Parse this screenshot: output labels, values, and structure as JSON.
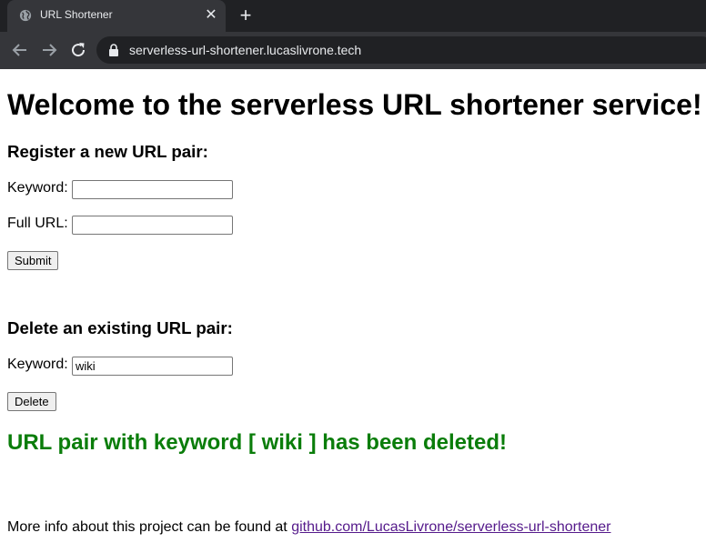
{
  "browser": {
    "tab_title": "URL Shortener",
    "tab_icon": "globe-icon",
    "url": "serverless-url-shortener.lucaslivrone.tech"
  },
  "page": {
    "title": "Welcome to the serverless URL shortener service!",
    "register": {
      "heading": "Register a new URL pair:",
      "keyword_label": "Keyword:",
      "keyword_value": "",
      "full_url_label": "Full URL:",
      "full_url_value": "",
      "submit_label": "Submit"
    },
    "delete": {
      "heading": "Delete an existing URL pair:",
      "keyword_label": "Keyword:",
      "keyword_value": "wiki",
      "delete_label": "Delete"
    },
    "message": "URL pair with keyword [ wiki ] has been deleted!",
    "footer_text": "More info about this project can be found at ",
    "footer_link": "github.com/LucasLivrone/serverless-url-shortener"
  },
  "colors": {
    "success": "#0a7d0a",
    "visited_link": "#551a8b",
    "chrome_dark": "#202124",
    "chrome_tab": "#35363a"
  }
}
